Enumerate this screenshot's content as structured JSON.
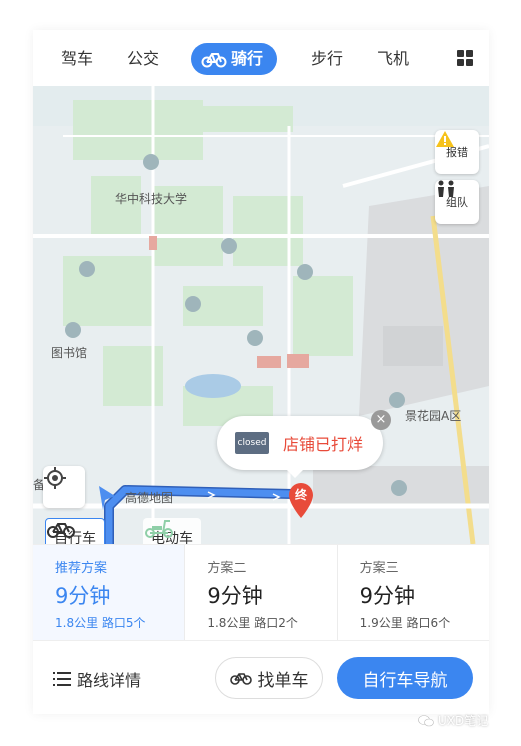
{
  "modes": [
    {
      "label": "驾车"
    },
    {
      "label": "公交"
    },
    {
      "label": "骑行"
    },
    {
      "label": "步行"
    },
    {
      "label": "飞机"
    }
  ],
  "map": {
    "poi_university": "华中科技大学",
    "poi_library": "图书馆",
    "poi_garden": "景花园A区",
    "poi_start": "高德地图",
    "poi_edge": "备"
  },
  "side_buttons": {
    "report": "报错",
    "team": "组队"
  },
  "bubble": {
    "sign": "closed",
    "text": "店铺已打烊",
    "close": "×"
  },
  "end_pin": "终",
  "vehicle_tabs": {
    "bicycle": "自行车",
    "ebike": "电动车"
  },
  "plans": [
    {
      "name": "推荐方案",
      "time": "9分钟",
      "distance": "1.8公里 路口5个"
    },
    {
      "name": "方案二",
      "time": "9分钟",
      "distance": "1.8公里 路口2个"
    },
    {
      "name": "方案三",
      "time": "9分钟",
      "distance": "1.9公里 路口6个"
    }
  ],
  "bottom": {
    "details": "路线详情",
    "find_bike": "找单车",
    "navigate": "自行车导航"
  },
  "watermark": "UXD笔记",
  "colors": {
    "accent": "#3b86f0",
    "closed_red": "#e84b3a"
  }
}
